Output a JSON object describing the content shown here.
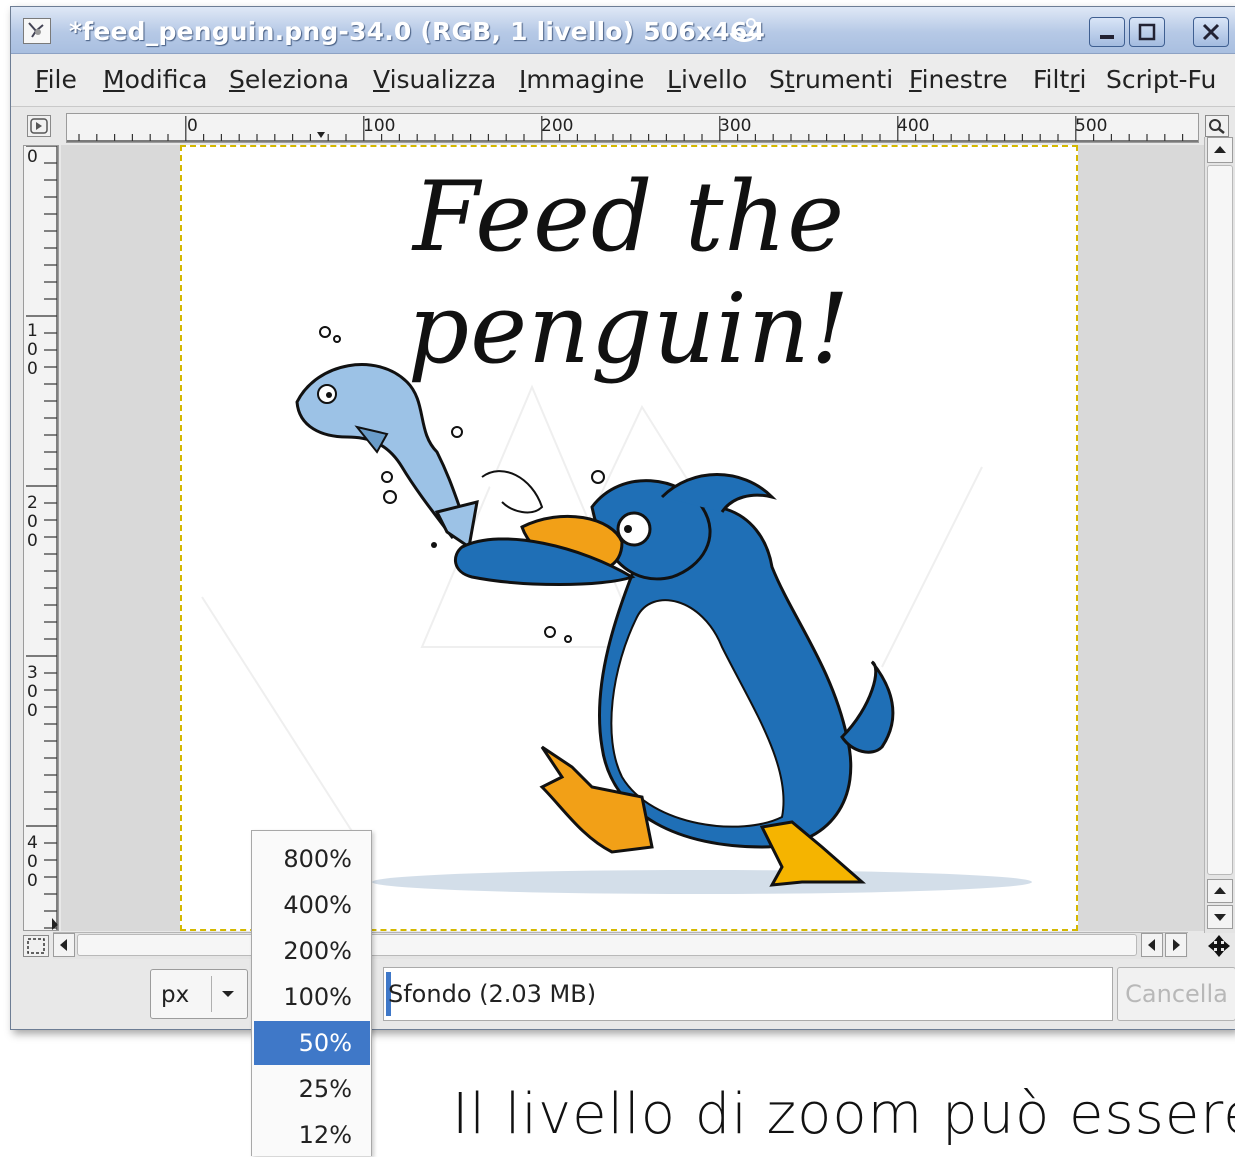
{
  "window": {
    "title": "*feed_penguin.png-34.0 (RGB, 1 livello) 506x464"
  },
  "menu": [
    {
      "label": "File",
      "ul": "F",
      "rest": "ile"
    },
    {
      "label": "Modifica",
      "ul": "M",
      "rest": "odifica"
    },
    {
      "label": "Seleziona",
      "ul": "S",
      "rest": "eleziona"
    },
    {
      "label": "Visualizza",
      "ul": "V",
      "rest": "isualizza"
    },
    {
      "label": "Immagine",
      "ul": "I",
      "rest": "mmagine"
    },
    {
      "label": "Livello",
      "ul": "L",
      "rest": "ivello"
    },
    {
      "label": "Strumenti",
      "pre": "S",
      "ul": "t",
      "rest": "rumenti"
    },
    {
      "label": "Finestre",
      "ul": "F",
      "rest": "inestre"
    },
    {
      "label": "Filtri",
      "pre": "Filt",
      "ul": "r",
      "rest": "i"
    },
    {
      "label": "Script-Fu",
      "ul": "",
      "rest": "Script-Fu"
    }
  ],
  "rulers": {
    "horizontal_labels": [
      "0",
      "100",
      "200",
      "300",
      "400",
      "500"
    ],
    "vertical_labels": [
      "0",
      "100",
      "200",
      "300",
      "400"
    ]
  },
  "image": {
    "headline": "Feed the penguin!"
  },
  "statusbar": {
    "unit": "px",
    "status_text": "Sfondo (2.03 MB)",
    "cancel_label": "Cancella"
  },
  "zoom_menu": {
    "options": [
      "800%",
      "400%",
      "200%",
      "100%",
      "50%",
      "25%",
      "12%"
    ],
    "selected": "50%"
  },
  "caption": "Il livello di zoom può essere",
  "colors": {
    "titlebar": "#b6c9e6",
    "selection": "#3f78c8",
    "penguin_blue": "#1f6fb6",
    "beak_orange": "#f2a017",
    "marching_ants": "#d4b800"
  },
  "icons": [
    "gimp-app-icon",
    "minimize-icon",
    "maximize-icon",
    "close-icon",
    "quick-mask-icon",
    "navigate-icon",
    "zoom-icon",
    "arrow-up-icon",
    "arrow-down-icon",
    "arrow-left-icon",
    "arrow-right-icon",
    "chevron-down-icon"
  ]
}
